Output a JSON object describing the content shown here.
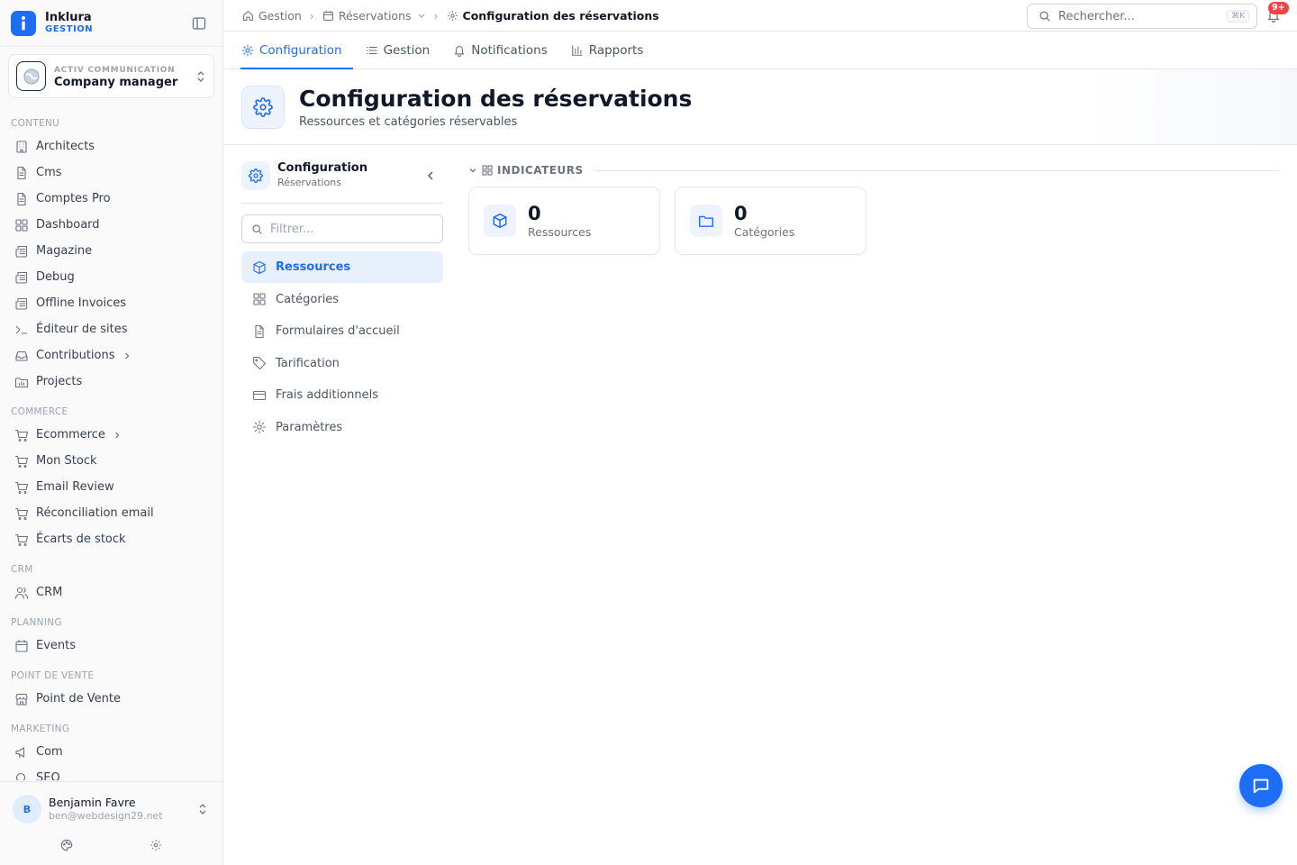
{
  "brand": {
    "name": "Inklura",
    "sub": "GESTION"
  },
  "company": {
    "org": "ACTIV COMMUNICATION",
    "role": "Company manager"
  },
  "nav": {
    "sections": [
      {
        "title": "CONTENU",
        "items": [
          {
            "label": "Architects",
            "icon": "building-icon"
          },
          {
            "label": "Cms",
            "icon": "file-icon"
          },
          {
            "label": "Comptes Pro",
            "icon": "file-icon"
          },
          {
            "label": "Dashboard",
            "icon": "grid-icon"
          },
          {
            "label": "Magazine",
            "icon": "newspaper-icon"
          },
          {
            "label": "Debug",
            "icon": "newspaper-icon"
          },
          {
            "label": "Offline Invoices",
            "icon": "newspaper-icon"
          },
          {
            "label": "Éditeur de sites",
            "icon": "terminal-icon"
          },
          {
            "label": "Contributions",
            "icon": "inbox-icon"
          },
          {
            "label": "Projects",
            "icon": "folder-chart-icon"
          }
        ]
      },
      {
        "title": "COMMERCE",
        "items": [
          {
            "label": "Ecommerce",
            "icon": "cart-icon"
          },
          {
            "label": "Mon Stock",
            "icon": "cart-icon"
          },
          {
            "label": "Email Review",
            "icon": "cart-icon"
          },
          {
            "label": "Réconciliation email",
            "icon": "cart-icon"
          },
          {
            "label": "Écarts de stock",
            "icon": "cart-icon"
          }
        ]
      },
      {
        "title": "CRM",
        "items": [
          {
            "label": "CRM",
            "icon": "users-icon"
          }
        ]
      },
      {
        "title": "PLANNING",
        "items": [
          {
            "label": "Events",
            "icon": "calendar-icon"
          }
        ]
      },
      {
        "title": "POINT DE VENTE",
        "items": [
          {
            "label": "Point de Vente",
            "icon": "store-icon"
          }
        ]
      },
      {
        "title": "MARKETING",
        "items": [
          {
            "label": "Com",
            "icon": "megaphone-icon"
          },
          {
            "label": "SEO",
            "icon": "search-icon"
          }
        ]
      }
    ]
  },
  "user": {
    "initial": "B",
    "name": "Benjamin Favre",
    "email": "ben@webdesign29.net"
  },
  "breadcrumb": {
    "home": "Gestion",
    "section": "Réservations",
    "current": "Configuration des réservations"
  },
  "search": {
    "placeholder": "Rechercher...",
    "shortcut": "⌘K"
  },
  "notifications": {
    "badge": "9+"
  },
  "tabs": [
    {
      "label": "Configuration",
      "icon": "gear-icon",
      "active": true
    },
    {
      "label": "Gestion",
      "icon": "list-icon",
      "active": false
    },
    {
      "label": "Notifications",
      "icon": "bell-icon",
      "active": false
    },
    {
      "label": "Rapports",
      "icon": "bar-chart-icon",
      "active": false
    }
  ],
  "header": {
    "title": "Configuration des réservations",
    "subtitle": "Ressources et catégories réservables"
  },
  "subnav": {
    "title": "Configuration",
    "subtitle": "Réservations",
    "filter_placeholder": "Filtrer...",
    "items": [
      {
        "label": "Ressources",
        "icon": "box-icon",
        "active": true
      },
      {
        "label": "Catégories",
        "icon": "grid-icon",
        "active": false
      },
      {
        "label": "Formulaires d'accueil",
        "icon": "file-icon",
        "active": false
      },
      {
        "label": "Tarification",
        "icon": "tag-icon",
        "active": false
      },
      {
        "label": "Frais additionnels",
        "icon": "credit-card-icon",
        "active": false
      },
      {
        "label": "Paramètres",
        "icon": "gear-icon",
        "active": false
      }
    ]
  },
  "indicators": {
    "title": "INDICATEURS",
    "cards": [
      {
        "value": "0",
        "label": "Ressources",
        "icon": "box-icon"
      },
      {
        "value": "0",
        "label": "Catégories",
        "icon": "folder-icon"
      }
    ]
  },
  "colors": {
    "accent": "#1d6ef5",
    "badge": "#ef4444"
  }
}
